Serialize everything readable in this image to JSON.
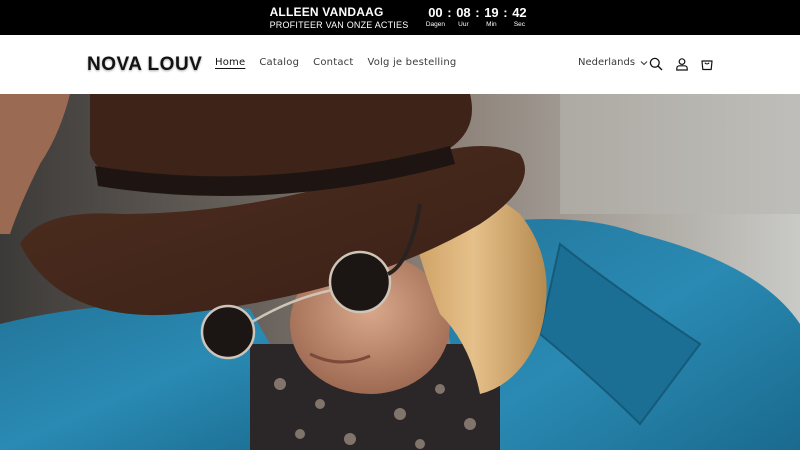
{
  "announcement": {
    "title": "ALLEEN VANDAAG",
    "subtitle": "PROFITEER VAN ONZE ACTIES",
    "countdown": [
      {
        "value": "00",
        "label": "Dagen"
      },
      {
        "value": "08",
        "label": "Uur"
      },
      {
        "value": "19",
        "label": "Min"
      },
      {
        "value": "42",
        "label": "Sec"
      }
    ],
    "separator": ":"
  },
  "header": {
    "logo": "NOVA LOUV",
    "nav": [
      {
        "label": "Home",
        "active": true
      },
      {
        "label": "Catalog",
        "active": false
      },
      {
        "label": "Contact",
        "active": false
      },
      {
        "label": "Volg je bestelling",
        "active": false
      }
    ],
    "language": "Nederlands",
    "icons": [
      "search-icon",
      "account-icon",
      "cart-icon"
    ]
  },
  "hero": {
    "image": "man-in-brown-hat-and-sunglasses-blue-jacket"
  },
  "colors": {
    "topbar_bg": "#000000",
    "topbar_text": "#ffffff",
    "header_bg": "#ffffff",
    "text": "#121212",
    "hat_brown": "#4a2a1c",
    "jacket_blue": "#1f7fa8"
  }
}
